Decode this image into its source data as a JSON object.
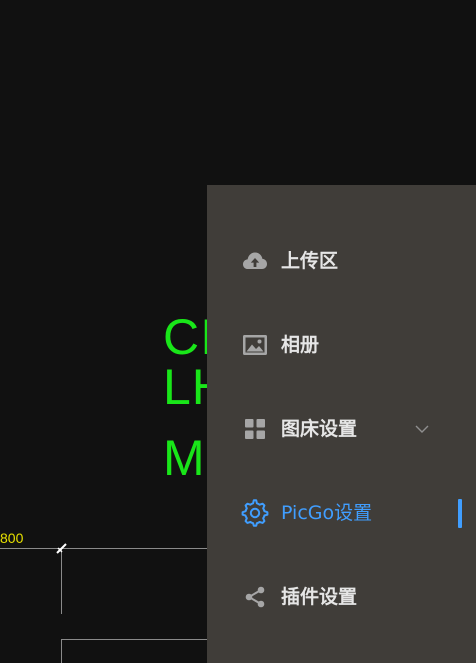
{
  "background": {
    "cad_lines": [
      "CI",
      "LH",
      "M"
    ],
    "dimension_label": "800"
  },
  "sidebar": {
    "items": [
      {
        "label": "上传区",
        "icon": "cloud-upload-icon",
        "active": false
      },
      {
        "label": "相册",
        "icon": "image-icon",
        "active": false
      },
      {
        "label": "图床设置",
        "icon": "grid-icon",
        "active": false,
        "expandable": true
      },
      {
        "label": "PicGo设置",
        "icon": "gear-icon",
        "active": true
      },
      {
        "label": "插件设置",
        "icon": "share-icon",
        "active": false
      }
    ]
  },
  "colors": {
    "sidebar_bg": "#403d39",
    "accent": "#409eff",
    "text": "#e6e6e6",
    "icon": "#a6a6a6",
    "cad_green": "#19e619",
    "cad_yellow": "#e6e000",
    "canvas_bg": "#111111"
  }
}
